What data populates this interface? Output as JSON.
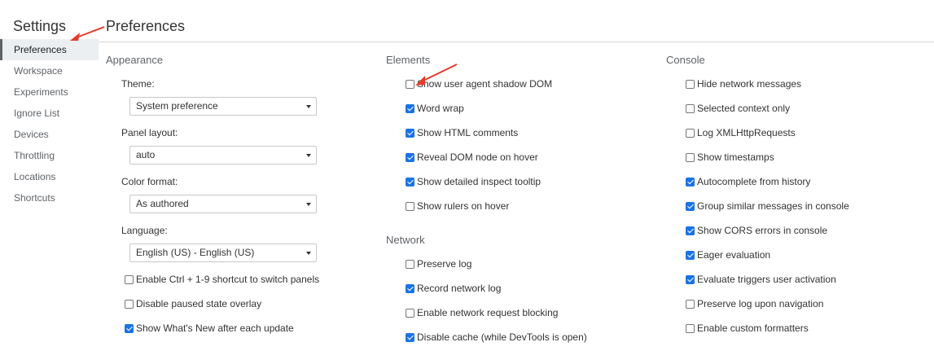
{
  "sidebar": {
    "title": "Settings",
    "items": [
      {
        "label": "Preferences"
      },
      {
        "label": "Workspace"
      },
      {
        "label": "Experiments"
      },
      {
        "label": "Ignore List"
      },
      {
        "label": "Devices"
      },
      {
        "label": "Throttling"
      },
      {
        "label": "Locations"
      },
      {
        "label": "Shortcuts"
      }
    ]
  },
  "main": {
    "title": "Preferences",
    "appearance": {
      "title": "Appearance",
      "theme_label": "Theme:",
      "theme_value": "System preference",
      "panel_layout_label": "Panel layout:",
      "panel_layout_value": "auto",
      "color_format_label": "Color format:",
      "color_format_value": "As authored",
      "language_label": "Language:",
      "language_value": "English (US) - English (US)",
      "checkboxes": [
        {
          "label": "Enable Ctrl + 1-9 shortcut to switch panels",
          "checked": false
        },
        {
          "label": "Disable paused state overlay",
          "checked": false
        },
        {
          "label": "Show What's New after each update",
          "checked": true
        }
      ]
    },
    "elements": {
      "title": "Elements",
      "checkboxes": [
        {
          "label": "Show user agent shadow DOM",
          "checked": false
        },
        {
          "label": "Word wrap",
          "checked": true
        },
        {
          "label": "Show HTML comments",
          "checked": true
        },
        {
          "label": "Reveal DOM node on hover",
          "checked": true
        },
        {
          "label": "Show detailed inspect tooltip",
          "checked": true
        },
        {
          "label": "Show rulers on hover",
          "checked": false
        }
      ]
    },
    "network": {
      "title": "Network",
      "checkboxes": [
        {
          "label": "Preserve log",
          "checked": false
        },
        {
          "label": "Record network log",
          "checked": true
        },
        {
          "label": "Enable network request blocking",
          "checked": false
        },
        {
          "label": "Disable cache (while DevTools is open)",
          "checked": true
        }
      ]
    },
    "console": {
      "title": "Console",
      "checkboxes": [
        {
          "label": "Hide network messages",
          "checked": false
        },
        {
          "label": "Selected context only",
          "checked": false
        },
        {
          "label": "Log XMLHttpRequests",
          "checked": false
        },
        {
          "label": "Show timestamps",
          "checked": false
        },
        {
          "label": "Autocomplete from history",
          "checked": true
        },
        {
          "label": "Group similar messages in console",
          "checked": true
        },
        {
          "label": "Show CORS errors in console",
          "checked": true
        },
        {
          "label": "Eager evaluation",
          "checked": true
        },
        {
          "label": "Evaluate triggers user activation",
          "checked": true
        },
        {
          "label": "Preserve log upon navigation",
          "checked": false
        },
        {
          "label": "Enable custom formatters",
          "checked": false
        }
      ]
    }
  },
  "colors": {
    "accent": "#1a73e8",
    "annotation_arrow": "#e8392b"
  }
}
